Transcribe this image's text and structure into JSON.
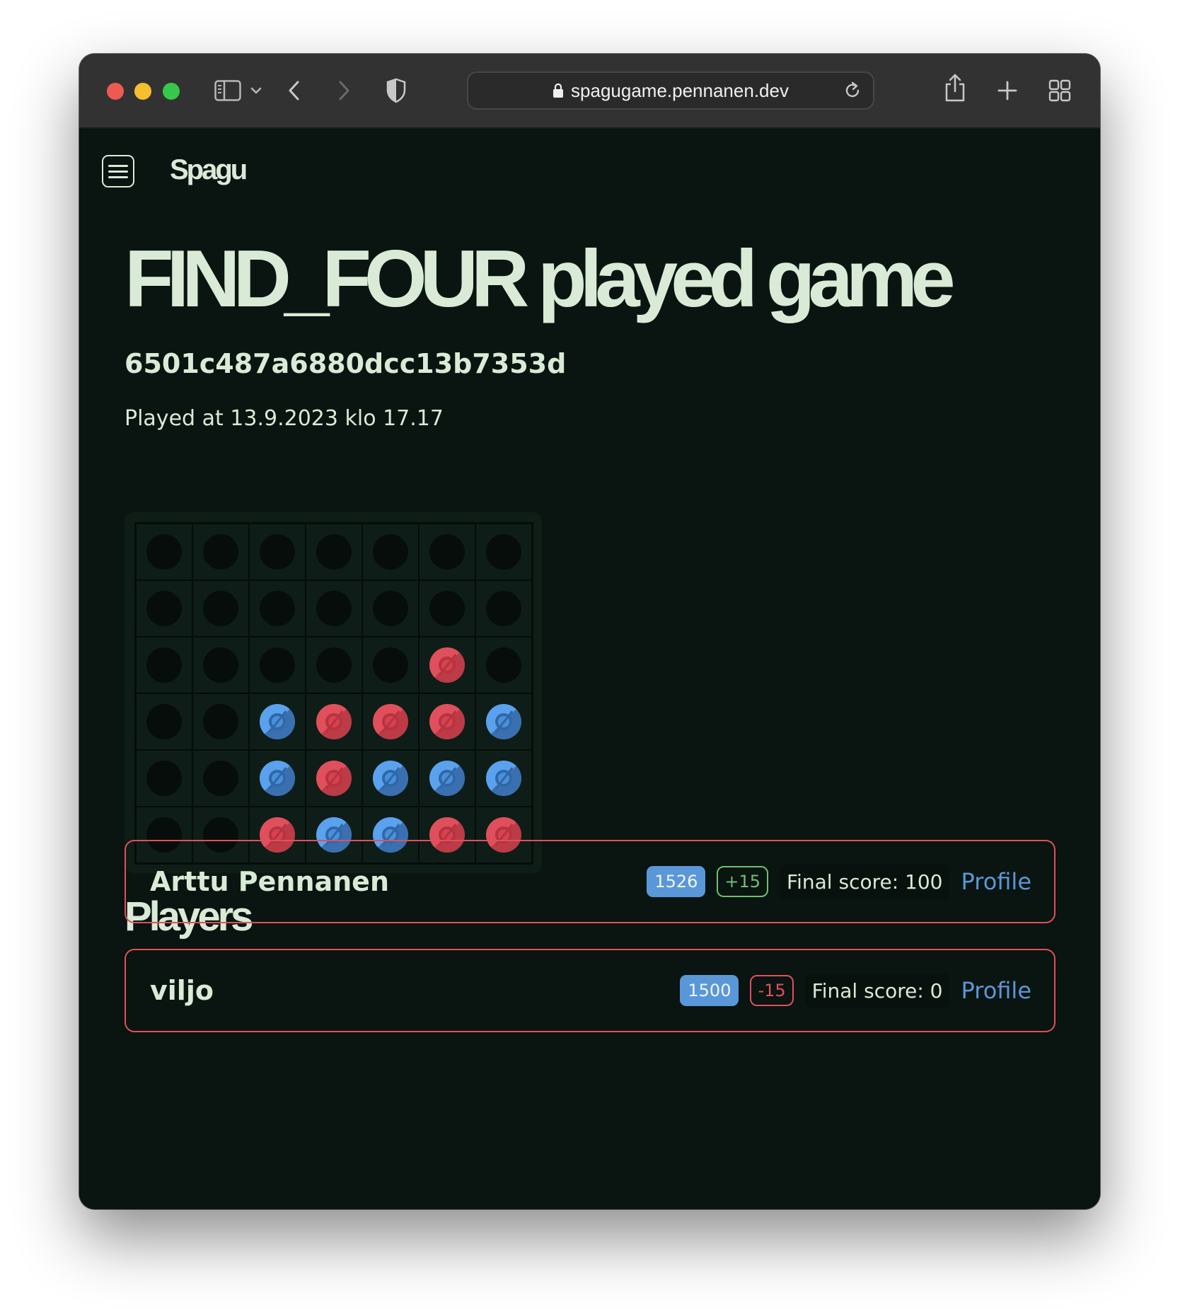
{
  "browser": {
    "url": "spagugame.pennanen.dev",
    "traffic_lights": {
      "close": "#ee5a52",
      "minimize": "#f5bf2f",
      "maximize": "#36c84a"
    }
  },
  "header": {
    "brand": "Spagu"
  },
  "game": {
    "title": "FIND_FOUR played game",
    "id": "6501c487a6880dcc13b7353d",
    "played_at": "Played at 13.9.2023 klo 17.17",
    "board": {
      "columns": 7,
      "rows": 6,
      "cells": [
        [
          "empty",
          "empty",
          "empty",
          "empty",
          "empty",
          "empty",
          "empty"
        ],
        [
          "empty",
          "empty",
          "empty",
          "empty",
          "empty",
          "empty",
          "empty"
        ],
        [
          "empty",
          "empty",
          "empty",
          "empty",
          "empty",
          "red",
          "empty"
        ],
        [
          "empty",
          "empty",
          "blue",
          "red",
          "red",
          "red",
          "blue"
        ],
        [
          "empty",
          "empty",
          "blue",
          "red",
          "blue",
          "blue",
          "blue"
        ],
        [
          "empty",
          "empty",
          "red",
          "blue",
          "blue",
          "red",
          "red"
        ]
      ]
    }
  },
  "players": {
    "heading": "Players",
    "list": [
      {
        "name": "Arttu Pennanen",
        "rating": "1526",
        "delta": "+15",
        "final_score": "Final score: 100",
        "profile_label": "Profile"
      },
      {
        "name": "viljo",
        "rating": "1500",
        "delta": "-15",
        "final_score": "Final score: 0",
        "profile_label": "Profile"
      }
    ]
  },
  "colors": {
    "background": "#0a1410",
    "text": "#d9ead6",
    "red_disc": "#e0505c",
    "blue_disc": "#5aa2ee",
    "accent_blue": "#5a97d8",
    "positive": "#6fbf73",
    "negative": "#e0505c"
  }
}
